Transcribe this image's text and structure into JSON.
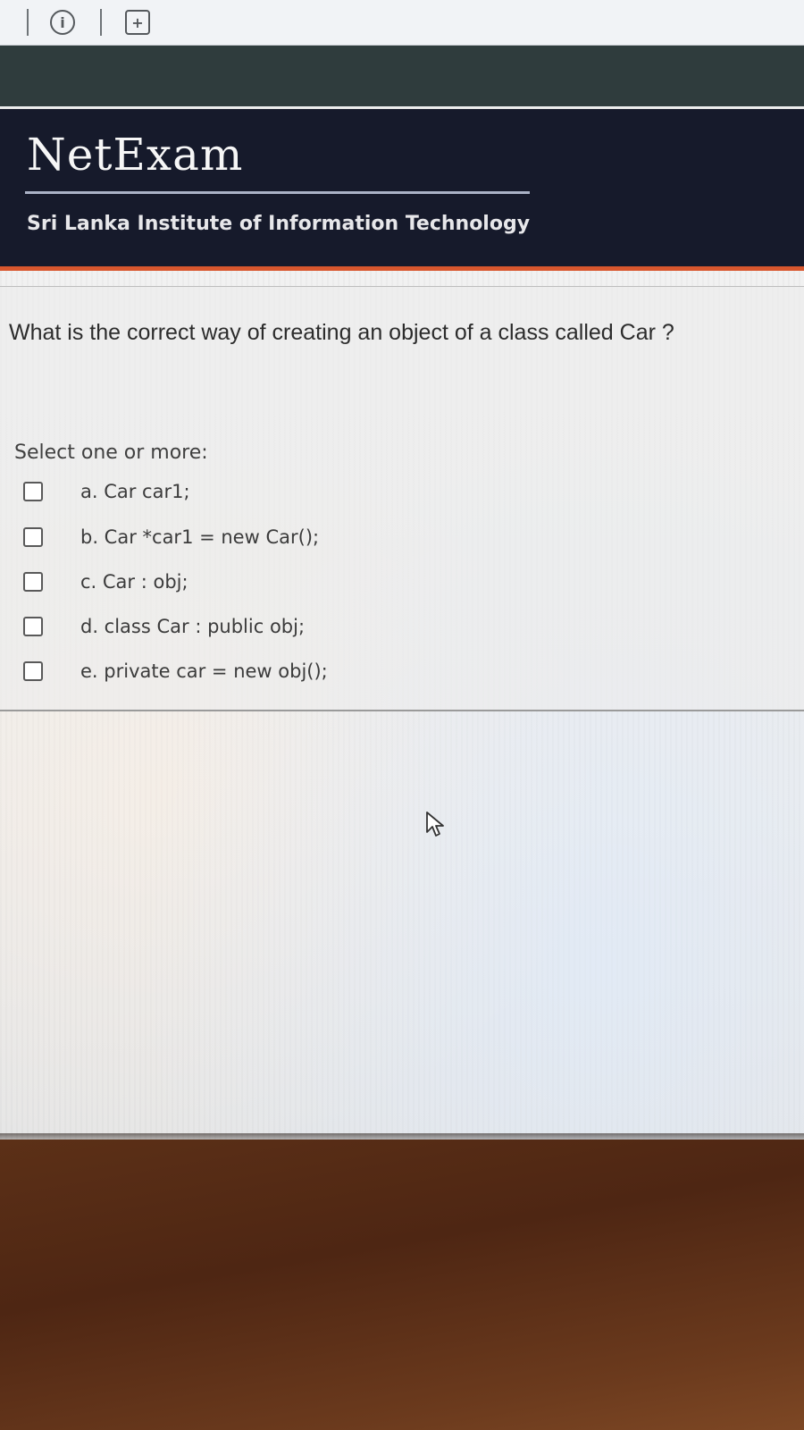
{
  "brand": {
    "name": "NetExam",
    "institute": "Sri Lanka Institute of Information Technology"
  },
  "toolbar": {
    "info_icon": "info-icon",
    "add_icon": "add-box-icon",
    "info_glyph": "i",
    "add_glyph": "+"
  },
  "question": {
    "text": "What is the correct way of creating an object of a class called Car ?",
    "prompt": "Select one or more:",
    "options": [
      {
        "label": "a. Car car1;",
        "checked": false
      },
      {
        "label": "b. Car *car1 = new Car();",
        "checked": false
      },
      {
        "label": "c. Car : obj;",
        "checked": false
      },
      {
        "label": "d. class Car : public obj;",
        "checked": false
      },
      {
        "label": "e. private car = new obj();",
        "checked": false
      }
    ]
  },
  "colors": {
    "banner": "#161a2b",
    "accent_line": "#d8572e",
    "header_band": "#2f3c3d"
  }
}
